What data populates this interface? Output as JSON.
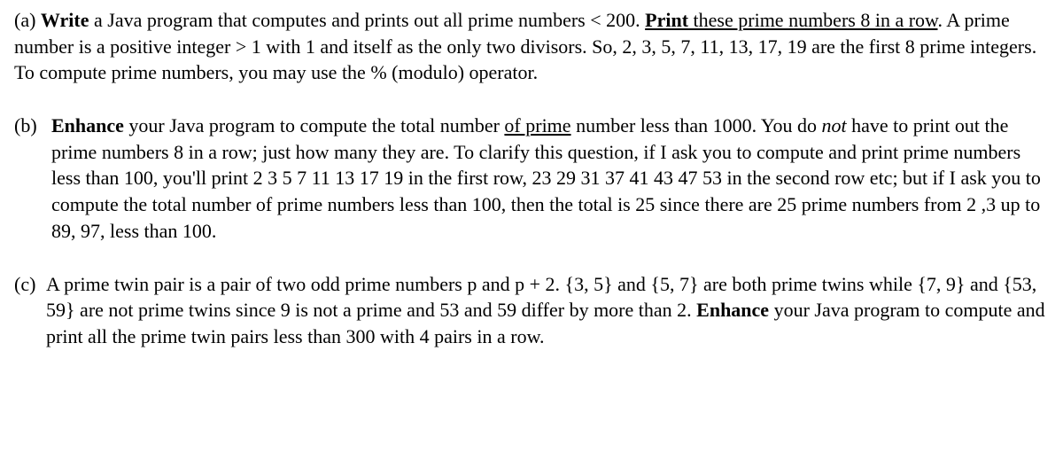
{
  "partA": {
    "label": "(a)",
    "boldWrite": "Write",
    "text1": " a Java program that computes and prints out all prime numbers < 200. ",
    "printUnderlineBold": "Print",
    "printUnderlineRest": " these prime numbers 8 in a row",
    "text2": ". A prime number is a positive integer > 1 with 1 and itself as the only two divisors. So, 2, 3, 5, 7, 11, 13, 17, 19 are the first 8 prime integers. To compute prime numbers, you may use the % (modulo) operator."
  },
  "partB": {
    "label": "(b)",
    "boldEnhance": "Enhance",
    "text1": " your Java program to compute the total number ",
    "underlineOfPrime": "of  prime",
    "text2": " number less than 1000. You do ",
    "italicNot": "not",
    "text3": " have to print out the prime numbers 8 in a row; just how many they are. To clarify this question, if I ask you to compute and print prime numbers less than 100,  you'll print 2 3 5 7 11 13 17 19 in the first row, 23 29 31 37 41 43 47 53 in the second row etc; but if I ask you to compute the total number of prime numbers less than 100, then the total is 25 since there are 25 prime numbers from 2 ,3 up to 89, 97, less than 100."
  },
  "partC": {
    "label": "(c)",
    "text1": "A prime twin pair is a pair of two odd prime numbers p and p + 2.  {3, 5} and {5, 7} are both prime twins while {7, 9} and {53, 59} are not prime twins since 9 is not a prime and 53 and 59 differ by more than 2. ",
    "boldEnhance": "Enhance",
    "text2": " your Java program to compute and print all the prime twin pairs less than 300 with 4 pairs in a row."
  }
}
